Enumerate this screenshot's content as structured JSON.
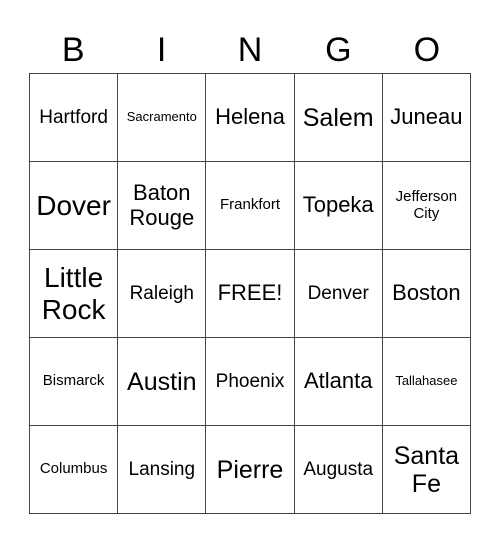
{
  "header": [
    "B",
    "I",
    "N",
    "G",
    "O"
  ],
  "rows": [
    [
      {
        "text": "Hartford",
        "size": "md"
      },
      {
        "text": "Sacramento",
        "size": "xs"
      },
      {
        "text": "Helena",
        "size": "lg"
      },
      {
        "text": "Salem",
        "size": "xl"
      },
      {
        "text": "Juneau",
        "size": "lg"
      }
    ],
    [
      {
        "text": "Dover",
        "size": "xxl"
      },
      {
        "text": "Baton Rouge",
        "size": "lg"
      },
      {
        "text": "Frankfort",
        "size": "sm"
      },
      {
        "text": "Topeka",
        "size": "lg"
      },
      {
        "text": "Jefferson City",
        "size": "sm"
      }
    ],
    [
      {
        "text": "Little Rock",
        "size": "xxl"
      },
      {
        "text": "Raleigh",
        "size": "md"
      },
      {
        "text": "FREE!",
        "size": "lg"
      },
      {
        "text": "Denver",
        "size": "md"
      },
      {
        "text": "Boston",
        "size": "lg"
      }
    ],
    [
      {
        "text": "Bismarck",
        "size": "sm"
      },
      {
        "text": "Austin",
        "size": "xl"
      },
      {
        "text": "Phoenix",
        "size": "md"
      },
      {
        "text": "Atlanta",
        "size": "lg"
      },
      {
        "text": "Tallahasee",
        "size": "xs"
      }
    ],
    [
      {
        "text": "Columbus",
        "size": "sm"
      },
      {
        "text": "Lansing",
        "size": "md"
      },
      {
        "text": "Pierre",
        "size": "xl"
      },
      {
        "text": "Augusta",
        "size": "md"
      },
      {
        "text": "Santa Fe",
        "size": "xl"
      }
    ]
  ]
}
